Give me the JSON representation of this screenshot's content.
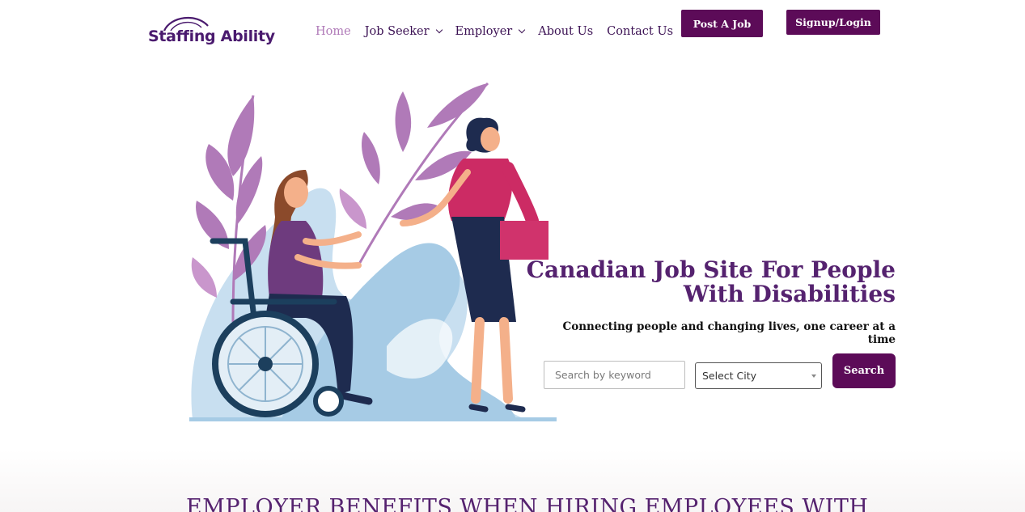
{
  "brand": {
    "logo_text": "Staffing Ability",
    "primary_color": "#5c0b58",
    "heading_color": "#55226f"
  },
  "nav": {
    "items": [
      {
        "label": "Home",
        "active": true
      },
      {
        "label": "Job Seeker",
        "has_dropdown": true
      },
      {
        "label": "Employer",
        "has_dropdown": true
      },
      {
        "label": "About Us"
      },
      {
        "label": "Contact Us"
      }
    ]
  },
  "header_buttons": {
    "post_job": "Post A Job",
    "signup_login": "Signup/Login"
  },
  "hero": {
    "title": "Canadian Job Site For People With Disabilities",
    "subtitle": "Connecting people and changing lives, one career at a time",
    "search": {
      "placeholder": "Search by keyword",
      "city_selected": "Select City",
      "button": "Search"
    }
  },
  "section": {
    "title": "EMPLOYER BENEFITS WHEN HIRING EMPLOYEES WITH"
  },
  "icons": [
    "chevron-down-icon",
    "select-caret-icon",
    "logo-swoosh-icon"
  ]
}
